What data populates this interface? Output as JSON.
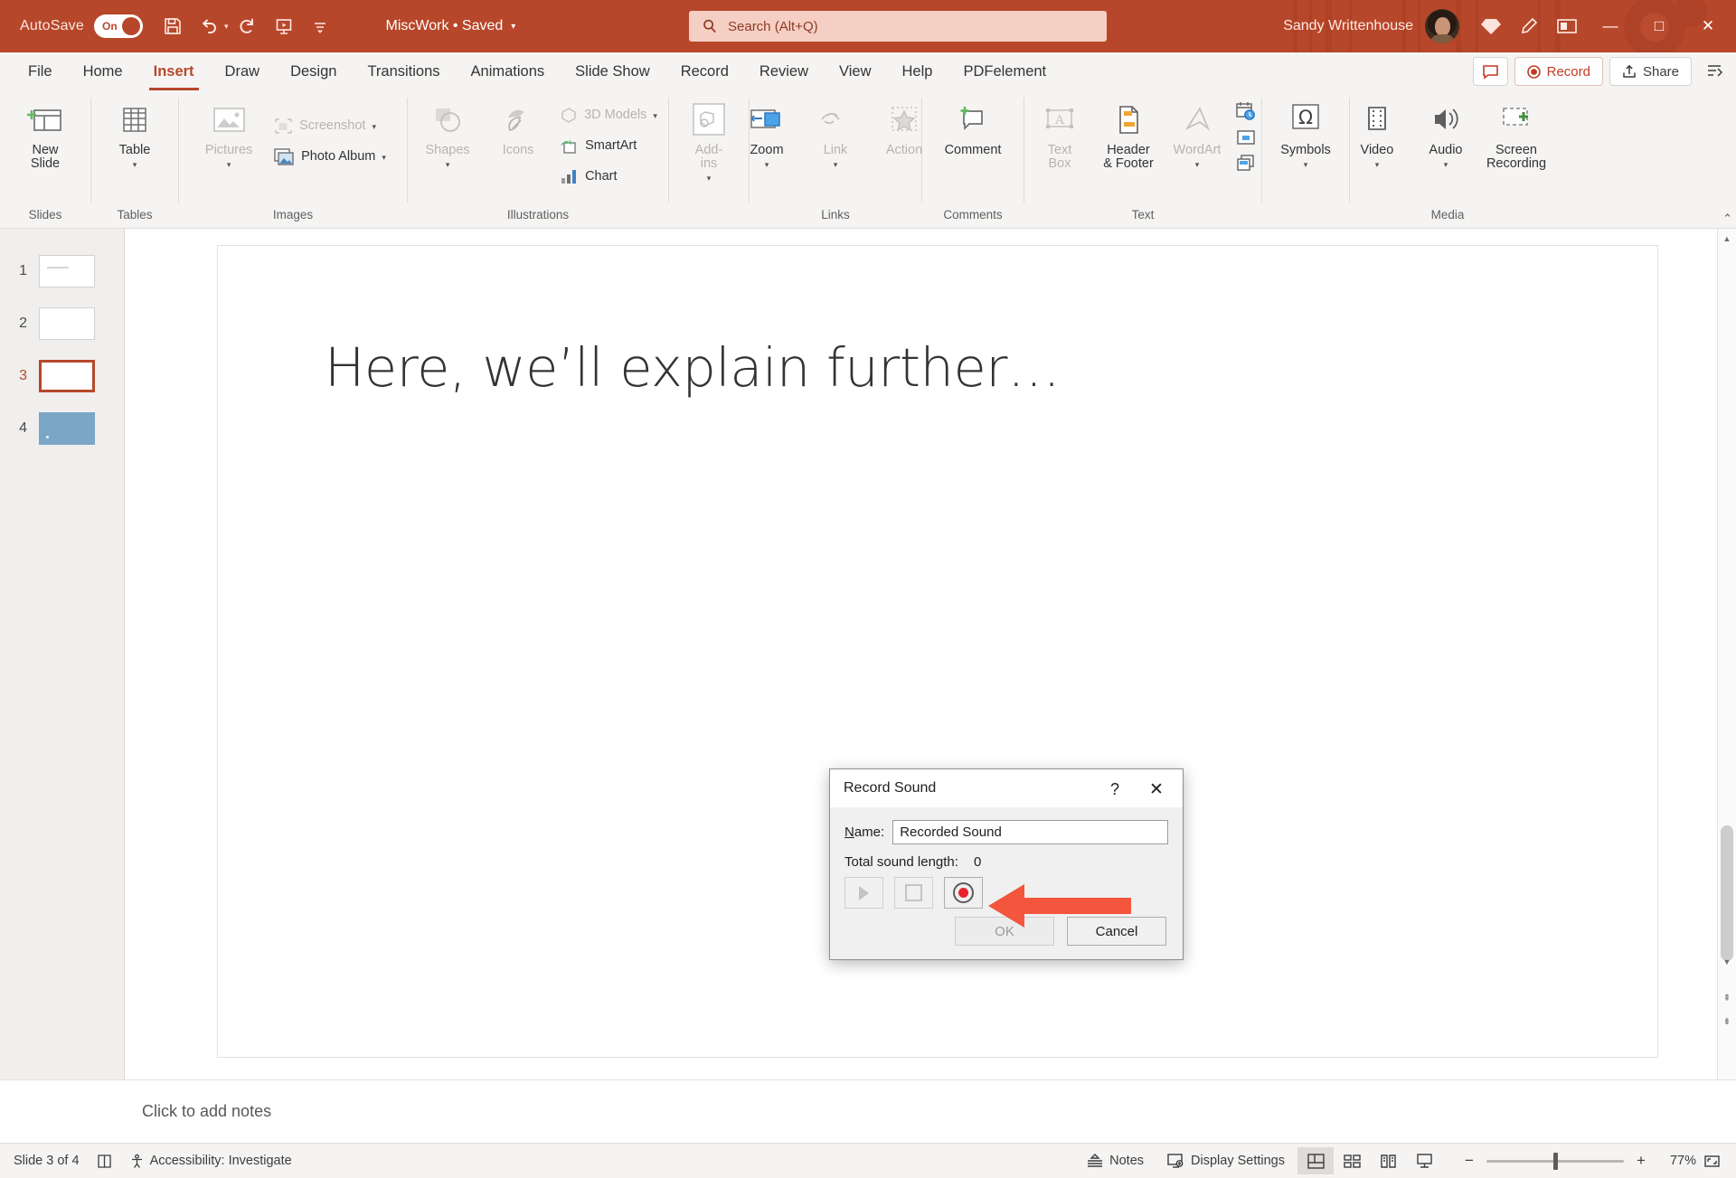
{
  "titlebar": {
    "autosave_label": "AutoSave",
    "autosave_state": "On",
    "document_title": "MiscWork • Saved",
    "search_placeholder": "Search (Alt+Q)",
    "user_name": "Sandy Writtenhouse",
    "qat": [
      {
        "name": "save-icon",
        "label": "Save"
      },
      {
        "name": "undo-icon",
        "label": "Undo"
      },
      {
        "name": "redo-icon",
        "label": "Redo"
      },
      {
        "name": "start-from-beginning-icon",
        "label": "Start From Beginning"
      },
      {
        "name": "customize-quick-access-toolbar-icon",
        "label": "Customize Quick Access Toolbar"
      }
    ],
    "window_controls": {
      "minimize": "—",
      "maximize": "□",
      "close": "✕"
    }
  },
  "tabs": [
    {
      "label": "File",
      "active": false
    },
    {
      "label": "Home",
      "active": false
    },
    {
      "label": "Insert",
      "active": true
    },
    {
      "label": "Draw",
      "active": false
    },
    {
      "label": "Design",
      "active": false
    },
    {
      "label": "Transitions",
      "active": false
    },
    {
      "label": "Animations",
      "active": false
    },
    {
      "label": "Slide Show",
      "active": false
    },
    {
      "label": "Record",
      "active": false
    },
    {
      "label": "Review",
      "active": false
    },
    {
      "label": "View",
      "active": false
    },
    {
      "label": "Help",
      "active": false
    },
    {
      "label": "PDFelement",
      "active": false
    }
  ],
  "tabs_right": {
    "comments_label": "",
    "record_label": "Record",
    "share_label": "Share",
    "ribbon_display_label": ""
  },
  "ribbon": {
    "groups": [
      {
        "label": "Slides",
        "big": [
          {
            "label": "New\nSlide",
            "dropdown": true,
            "disabled": false,
            "icon": "new-slide-icon"
          }
        ]
      },
      {
        "label": "Tables",
        "big": [
          {
            "label": "Table",
            "dropdown": true,
            "disabled": false,
            "icon": "table-icon"
          }
        ]
      },
      {
        "label": "Images",
        "big": [
          {
            "label": "Pictures",
            "dropdown": true,
            "disabled": true,
            "icon": "pictures-icon"
          }
        ],
        "small": [
          {
            "label": "Screenshot",
            "dropdown": true,
            "disabled": true,
            "icon": "screenshot-icon"
          },
          {
            "label": "Photo Album",
            "dropdown": true,
            "disabled": false,
            "icon": "photo-album-icon"
          }
        ]
      },
      {
        "label": "Illustrations",
        "big": [
          {
            "label": "Shapes",
            "dropdown": true,
            "disabled": true,
            "icon": "shapes-icon"
          },
          {
            "label": "Icons",
            "dropdown": false,
            "disabled": true,
            "icon": "icons-icon"
          }
        ],
        "small": [
          {
            "label": "3D Models",
            "dropdown": true,
            "disabled": true,
            "icon": "3d-models-icon"
          },
          {
            "label": "SmartArt",
            "dropdown": false,
            "disabled": false,
            "icon": "smartart-icon"
          },
          {
            "label": "Chart",
            "dropdown": false,
            "disabled": false,
            "icon": "chart-icon"
          }
        ]
      },
      {
        "label": "",
        "big": [
          {
            "label": "Add-\nins",
            "dropdown": true,
            "disabled": true,
            "icon": "add-ins-icon"
          }
        ]
      },
      {
        "label": "Links",
        "big": [
          {
            "label": "Zoom",
            "dropdown": true,
            "disabled": false,
            "icon": "zoom-icon"
          },
          {
            "label": "Link",
            "dropdown": true,
            "disabled": true,
            "icon": "link-icon"
          },
          {
            "label": "Action",
            "dropdown": false,
            "disabled": true,
            "icon": "action-icon"
          }
        ]
      },
      {
        "label": "Comments",
        "big": [
          {
            "label": "Comment",
            "dropdown": false,
            "disabled": false,
            "icon": "comment-icon"
          }
        ]
      },
      {
        "label": "Text",
        "big": [
          {
            "label": "Text\nBox",
            "dropdown": false,
            "disabled": true,
            "icon": "text-box-icon"
          },
          {
            "label": "Header\n& Footer",
            "dropdown": false,
            "disabled": false,
            "icon": "header-footer-icon"
          },
          {
            "label": "WordArt",
            "dropdown": true,
            "disabled": true,
            "icon": "wordart-icon"
          }
        ],
        "mini": [
          {
            "icon": "date-time-icon"
          },
          {
            "icon": "slide-number-icon"
          },
          {
            "icon": "object-icon"
          }
        ]
      },
      {
        "label": "",
        "big": [
          {
            "label": "Symbols",
            "dropdown": true,
            "disabled": false,
            "icon": "symbols-icon"
          }
        ]
      },
      {
        "label": "Media",
        "big": [
          {
            "label": "Video",
            "dropdown": true,
            "disabled": false,
            "icon": "video-icon"
          },
          {
            "label": "Audio",
            "dropdown": true,
            "disabled": false,
            "icon": "audio-icon"
          },
          {
            "label": "Screen\nRecording",
            "dropdown": false,
            "disabled": false,
            "icon": "screen-recording-icon"
          }
        ]
      }
    ]
  },
  "slides_panel": [
    {
      "number": "1",
      "selected": false,
      "style": "lined"
    },
    {
      "number": "2",
      "selected": false,
      "style": "blank"
    },
    {
      "number": "3",
      "selected": true,
      "style": "blank"
    },
    {
      "number": "4",
      "selected": false,
      "style": "blue"
    }
  ],
  "slide": {
    "title": "Here, we’ll explain further…"
  },
  "dialog": {
    "title": "Record Sound",
    "help_glyph": "?",
    "close_glyph": "✕",
    "name_label": "Name:",
    "name_value": "Recorded Sound",
    "length_label": "Total sound length:",
    "length_value": "0",
    "buttons": {
      "play": "Play",
      "stop": "Stop",
      "record": "Record",
      "ok": "OK",
      "cancel": "Cancel"
    },
    "annotation": {
      "type": "arrow",
      "color": "#f4553d",
      "points_to": "record-button"
    }
  },
  "notes": {
    "placeholder": "Click to add notes"
  },
  "statusbar": {
    "slide_counter": "Slide 3 of 4",
    "language_icon": "language-icon",
    "accessibility": "Accessibility: Investigate",
    "notes_label": "Notes",
    "display_settings_label": "Display Settings",
    "views": [
      {
        "name": "normal-view",
        "active": true
      },
      {
        "name": "slide-sorter-view",
        "active": false
      },
      {
        "name": "reading-view",
        "active": false
      },
      {
        "name": "slide-show-view",
        "active": false
      }
    ],
    "zoom_out": "−",
    "zoom_in": "+",
    "zoom_level": "77%"
  },
  "colors": {
    "brand": "#b7472a",
    "ribbon_bg": "#f5f4f3",
    "accent_red": "#e8242a",
    "annotation": "#f4553d"
  }
}
